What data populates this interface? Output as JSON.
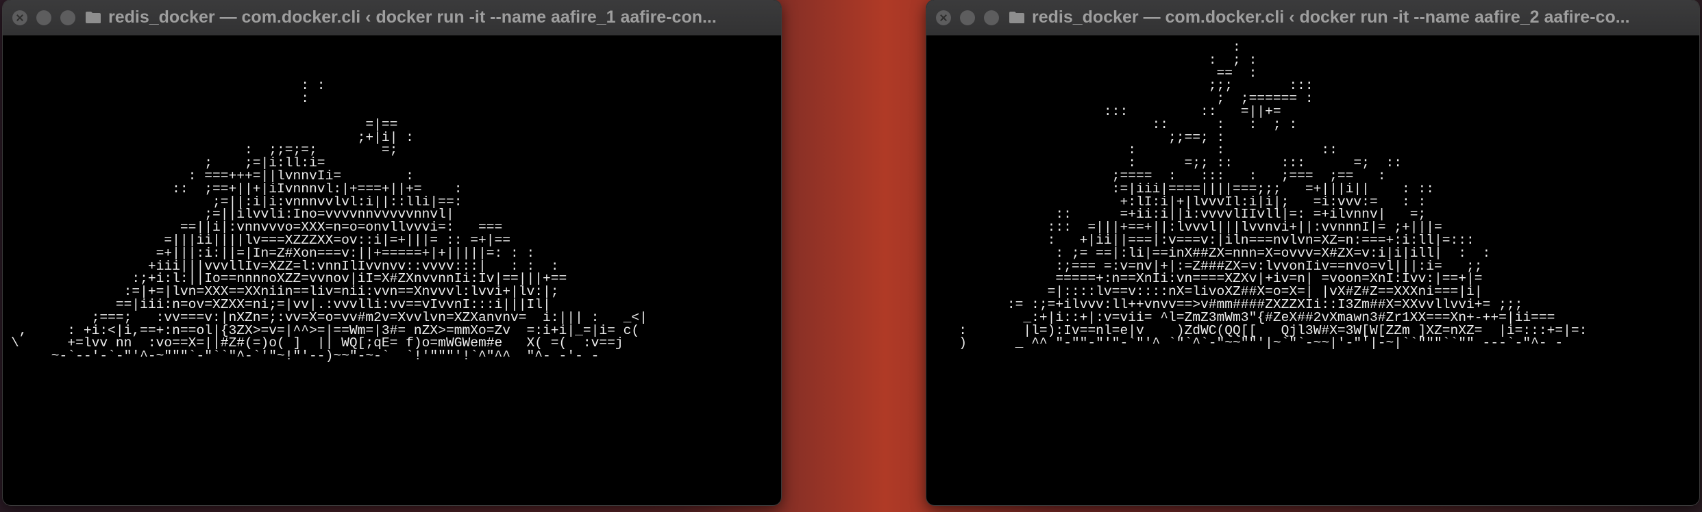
{
  "windows": [
    {
      "title": "redis_docker — com.docker.cli ‹ docker run -it --name aafire_1 aafire-con...",
      "lines": [
        "",
        "",
        "",
        "                                    : :",
        "                                    :",
        "",
        "                                            =|==",
        "                                           ;+|i| :",
        "                             :  ;;=;=;        =;",
        "                        ;    ;=|i:ll:i=",
        "                      : ===+++=||lvnnvIi=        :",
        "                    ::  ;==+||+|iIvnnnvl:|+===+||+=    :",
        "                         ;=||:i|i:vnnnvvlvl:i||::lli|==:",
        "                        ;=||ilvvli:Ino=vvvvnnvvvvvnnvl|",
        "                     ==||i|:vnnvvvo=XXX=n=o=onvllvvvi=:   ===",
        "                   =|||ii||||lv===XZZZXX=ov::i|=+|||= :: =+|==",
        "                  =+|||:i:||=|In=Z#Xon===v:||+=====+|+|||||=: : :",
        "                 +iii|||vvvllIv=XZZ=l:vnnIlIvvnvv::vvvv:::|   : :  :",
        "               :;+i:l:||Io==nnnnoXZZ=vvnov|iI=X#ZXnvvnnIi:Iv|==|||+==",
        "              :=|+=|lvn=XXX==XXniin==liv=nii:vvn==Xnvvvl:lvvi+|lv:|;",
        "             ==|iii:n=ov=XZXX=ni;=|vv|.:vvvlli:vv==vIvvnI:::i|||Il|",
        "          ;===;   :vv===v:|nXZn=;:vv=X=o=vv#m2v=Xvvlvn=XZXanvnv=  i:||| :   _<|",
        " ,     : +i:<|i,==+:n==ol|{3ZX>=v=|^^>=|==Wm=|3#= nZX>=mmXo=Zv  =:i+i|_=|i= c(",
        "\\      +=lvv nn  :vo==X=||#Z#(=)o( ]  || WQ[;qE= f)o=mWGWem#e   X( =(  :v==j",
        "     ~-`--'-`-\"'^-~\"\"\"`-\"``\"^-`'\"~!\"'--)~~\"-~-`  `!'\"\"\"'!`^\"^^  \"^- -'- -"
      ]
    },
    {
      "title": "redis_docker — com.docker.cli ‹ docker run -it --name aafire_2 aafire-co...",
      "lines": [
        "                                     :",
        "                                  :  ; :",
        "                                   ==  :",
        "                                  ;;;       :::",
        "                                   ;  ;====== :",
        "                     :::         ::   =||+=",
        "                           ::      :   :  ; :",
        "                             ;;==; :",
        "                        :          :            ::",
        "                        :      =;; ::      :::      =;  ::",
        "                      ;====  :   :::   :   ;===  ;==   :",
        "                      :=|iii|====||||===;;;   =+|||i||    : ::",
        "                       +:lI:i|+|lvvvIl:i|i|;   =i:vvv:=   : :",
        "               ::      =+ii:i||i:vvvvlIIvll|=: =+ilvnnv|   =;",
        "              :::  =|||+==+||:lvvvl|||lvvnvi+||:vvnnnI|= ;+|||=",
        "              :   +|ii||===|:v===v:|iln===nvlvn=XZ=n:===+:i:ll|=:::",
        "               : ;= ==|:li|==inX##ZX=nnn=X=ovvv=X#ZX=v:i|i|ill|  :  :",
        "               :;=== =:v=nv|+|:=Z###ZX=v:lvvonIiv==nvo=vl|||:i=   ;;",
        "               =====+:n==XnIi:vn====XZXv|+iv=n| =voon=XnI:Ivv:|==+|=",
        "              =|::::lv==v::::nX=livoXZ##X=o=X=| |vX#Z#Z==XXXni===|i|",
        "         := :;=+ilvvv:ll++vnvv==>v#mm####ZXZZXIi::I3Zm##X=XXvvllvvi+= ;;;",
        "           _:+|i::+|:v=vii= ^l=ZmZ3mWm3\"{#ZeX##2vXmawn3#Zr1XX===Xn+-++=|ii===",
        "   :       |l=):Iv==nl=e|v    )ZdWC(QQ[[   Qjl3W#X=3W[W[ZZm ]XZ=nXZ=  |i=:::+=|=:",
        "   )      _ ^^ \"-\"\"-\"'\"-`\"'^ `\"`^`-\"~~\"\"'|~`\"`-~~|'-\"'|-~|``\"\"\"``\"\" ---`-\"^- -"
      ]
    }
  ]
}
